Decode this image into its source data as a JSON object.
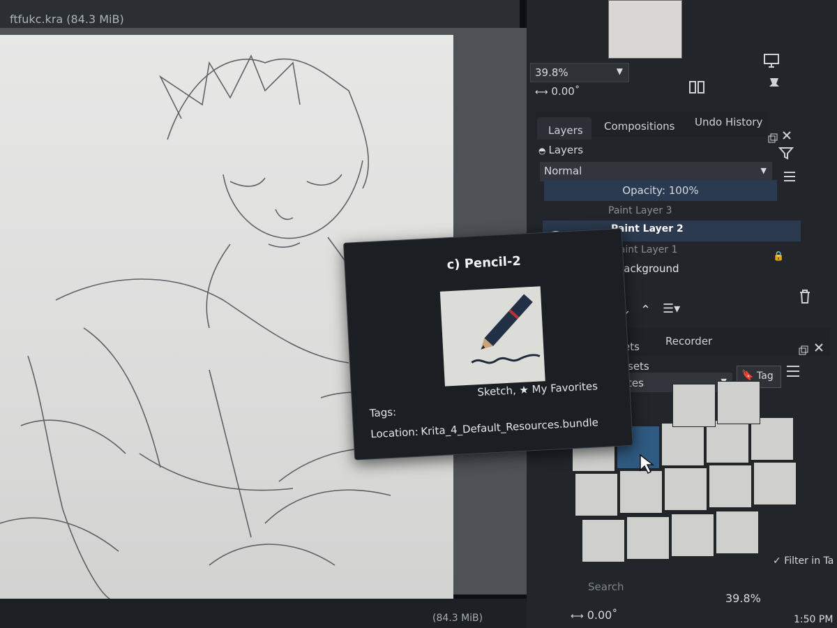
{
  "document": {
    "title": "ftfukc.kra (84.3 MiB)",
    "status_size": "(84.3 MiB)"
  },
  "overview": {
    "zoom": "39.8%",
    "rotation": "0.00˚"
  },
  "docker_tabs": [
    "Layers",
    "Compositions",
    "Undo History"
  ],
  "layers_panel": {
    "title": "Layers",
    "blend_mode": "Normal",
    "opacity": "Opacity:  100%",
    "layers": [
      {
        "name": "Paint Layer 3",
        "active": false
      },
      {
        "name": "Paint Layer 2",
        "active": true
      },
      {
        "name": "Paint Layer 1",
        "active": false
      },
      {
        "name": "Background",
        "active": false
      }
    ]
  },
  "presets_panel": {
    "tabs": [
      "ets",
      "Recorder"
    ],
    "title": "sets",
    "filter_combo": "tes",
    "tag_button": "Tag",
    "search_placeholder": "Search",
    "filter_checkbox": "Filter in Ta"
  },
  "tooltip": {
    "title": "c) Pencil-2",
    "tags_label": "Tags:",
    "tags_value": "Sketch, ★ My Favorites",
    "location_label": "Location:",
    "location_value": "Krita_4_Default_Resources.bundle"
  },
  "bottom_bar": {
    "zoom": "39.8%",
    "rotation": "0.00˚",
    "time": "1:50 PM"
  },
  "icons": [
    "eye-icon",
    "trash-icon",
    "filter-icon",
    "menu-icon",
    "pin-icon",
    "monitor-icon",
    "mirror-icon",
    "float-icon",
    "close-icon",
    "chevron-down-icon",
    "chevron-up-icon",
    "tag-icon",
    "lock-icon"
  ],
  "colors": {
    "accent_selected": "#2b3a4f",
    "tooltip_bg": "#1b1e22",
    "docker_bg": "#22252a"
  }
}
